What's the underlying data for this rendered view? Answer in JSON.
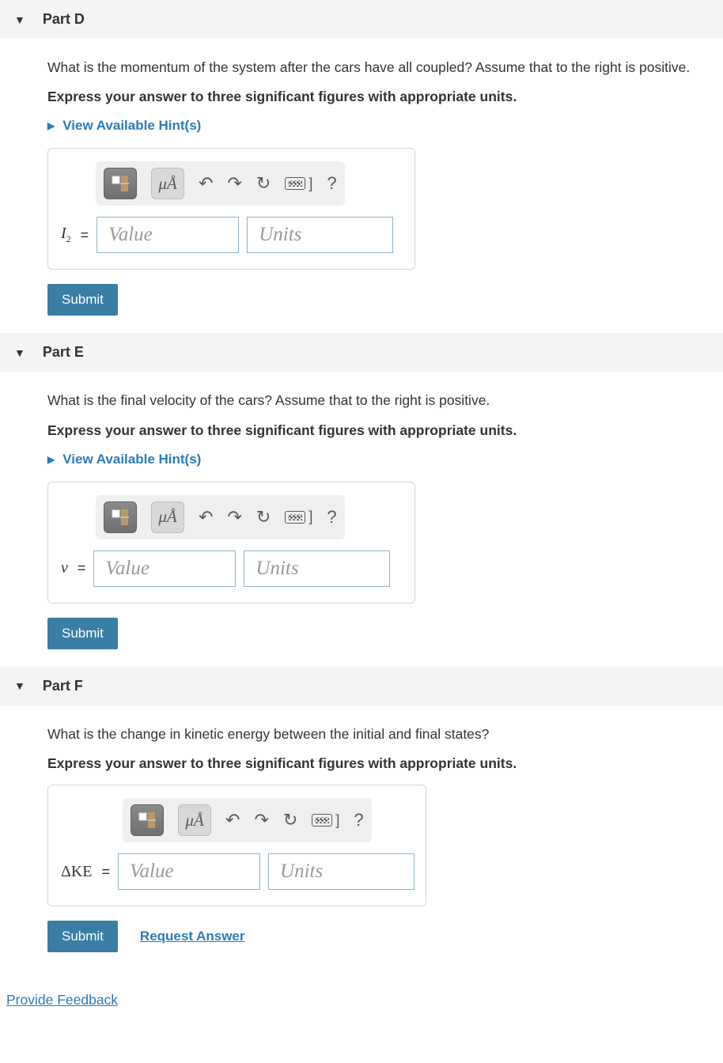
{
  "hint_label": "View Available Hint(s)",
  "value_placeholder": "Value",
  "units_placeholder": "Units",
  "submit_label": "Submit",
  "request_answer_label": "Request Answer",
  "provide_feedback_label": "Provide Feedback",
  "unit_button_label": "μÅ",
  "parts": {
    "d": {
      "title": "Part D",
      "prompt": "What is the momentum of the system after the cars have all coupled? Assume that to the right is positive.",
      "instruction": "Express your answer to three significant figures with appropriate units.",
      "variable_html": "<i>I</i><span class='sub'>2</span>",
      "show_hints": true,
      "show_request": false
    },
    "e": {
      "title": "Part E",
      "prompt": "What is the final velocity of the cars? Assume that to the right is positive.",
      "instruction": "Express your answer to three significant figures with appropriate units.",
      "variable_html": "<i>v</i>",
      "show_hints": true,
      "show_request": false
    },
    "f": {
      "title": "Part F",
      "prompt": "What is the change in kinetic energy between the initial and final states?",
      "instruction": "Express your answer to three significant figures with appropriate units.",
      "variable_html": "ΔKE",
      "show_hints": false,
      "show_request": true
    }
  }
}
